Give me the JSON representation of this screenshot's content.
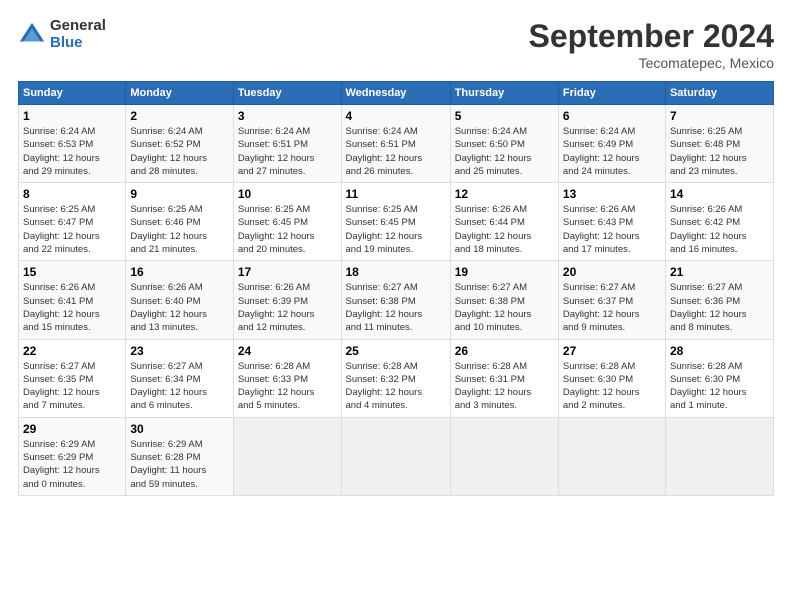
{
  "header": {
    "logo_general": "General",
    "logo_blue": "Blue",
    "month_title": "September 2024",
    "subtitle": "Tecomatepec, Mexico"
  },
  "days_of_week": [
    "Sunday",
    "Monday",
    "Tuesday",
    "Wednesday",
    "Thursday",
    "Friday",
    "Saturday"
  ],
  "weeks": [
    [
      {
        "num": "1",
        "info": "Sunrise: 6:24 AM\nSunset: 6:53 PM\nDaylight: 12 hours\nand 29 minutes."
      },
      {
        "num": "2",
        "info": "Sunrise: 6:24 AM\nSunset: 6:52 PM\nDaylight: 12 hours\nand 28 minutes."
      },
      {
        "num": "3",
        "info": "Sunrise: 6:24 AM\nSunset: 6:51 PM\nDaylight: 12 hours\nand 27 minutes."
      },
      {
        "num": "4",
        "info": "Sunrise: 6:24 AM\nSunset: 6:51 PM\nDaylight: 12 hours\nand 26 minutes."
      },
      {
        "num": "5",
        "info": "Sunrise: 6:24 AM\nSunset: 6:50 PM\nDaylight: 12 hours\nand 25 minutes."
      },
      {
        "num": "6",
        "info": "Sunrise: 6:24 AM\nSunset: 6:49 PM\nDaylight: 12 hours\nand 24 minutes."
      },
      {
        "num": "7",
        "info": "Sunrise: 6:25 AM\nSunset: 6:48 PM\nDaylight: 12 hours\nand 23 minutes."
      }
    ],
    [
      {
        "num": "8",
        "info": "Sunrise: 6:25 AM\nSunset: 6:47 PM\nDaylight: 12 hours\nand 22 minutes."
      },
      {
        "num": "9",
        "info": "Sunrise: 6:25 AM\nSunset: 6:46 PM\nDaylight: 12 hours\nand 21 minutes."
      },
      {
        "num": "10",
        "info": "Sunrise: 6:25 AM\nSunset: 6:45 PM\nDaylight: 12 hours\nand 20 minutes."
      },
      {
        "num": "11",
        "info": "Sunrise: 6:25 AM\nSunset: 6:45 PM\nDaylight: 12 hours\nand 19 minutes."
      },
      {
        "num": "12",
        "info": "Sunrise: 6:26 AM\nSunset: 6:44 PM\nDaylight: 12 hours\nand 18 minutes."
      },
      {
        "num": "13",
        "info": "Sunrise: 6:26 AM\nSunset: 6:43 PM\nDaylight: 12 hours\nand 17 minutes."
      },
      {
        "num": "14",
        "info": "Sunrise: 6:26 AM\nSunset: 6:42 PM\nDaylight: 12 hours\nand 16 minutes."
      }
    ],
    [
      {
        "num": "15",
        "info": "Sunrise: 6:26 AM\nSunset: 6:41 PM\nDaylight: 12 hours\nand 15 minutes."
      },
      {
        "num": "16",
        "info": "Sunrise: 6:26 AM\nSunset: 6:40 PM\nDaylight: 12 hours\nand 13 minutes."
      },
      {
        "num": "17",
        "info": "Sunrise: 6:26 AM\nSunset: 6:39 PM\nDaylight: 12 hours\nand 12 minutes."
      },
      {
        "num": "18",
        "info": "Sunrise: 6:27 AM\nSunset: 6:38 PM\nDaylight: 12 hours\nand 11 minutes."
      },
      {
        "num": "19",
        "info": "Sunrise: 6:27 AM\nSunset: 6:38 PM\nDaylight: 12 hours\nand 10 minutes."
      },
      {
        "num": "20",
        "info": "Sunrise: 6:27 AM\nSunset: 6:37 PM\nDaylight: 12 hours\nand 9 minutes."
      },
      {
        "num": "21",
        "info": "Sunrise: 6:27 AM\nSunset: 6:36 PM\nDaylight: 12 hours\nand 8 minutes."
      }
    ],
    [
      {
        "num": "22",
        "info": "Sunrise: 6:27 AM\nSunset: 6:35 PM\nDaylight: 12 hours\nand 7 minutes."
      },
      {
        "num": "23",
        "info": "Sunrise: 6:27 AM\nSunset: 6:34 PM\nDaylight: 12 hours\nand 6 minutes."
      },
      {
        "num": "24",
        "info": "Sunrise: 6:28 AM\nSunset: 6:33 PM\nDaylight: 12 hours\nand 5 minutes."
      },
      {
        "num": "25",
        "info": "Sunrise: 6:28 AM\nSunset: 6:32 PM\nDaylight: 12 hours\nand 4 minutes."
      },
      {
        "num": "26",
        "info": "Sunrise: 6:28 AM\nSunset: 6:31 PM\nDaylight: 12 hours\nand 3 minutes."
      },
      {
        "num": "27",
        "info": "Sunrise: 6:28 AM\nSunset: 6:30 PM\nDaylight: 12 hours\nand 2 minutes."
      },
      {
        "num": "28",
        "info": "Sunrise: 6:28 AM\nSunset: 6:30 PM\nDaylight: 12 hours\nand 1 minute."
      }
    ],
    [
      {
        "num": "29",
        "info": "Sunrise: 6:29 AM\nSunset: 6:29 PM\nDaylight: 12 hours\nand 0 minutes."
      },
      {
        "num": "30",
        "info": "Sunrise: 6:29 AM\nSunset: 6:28 PM\nDaylight: 11 hours\nand 59 minutes."
      },
      {
        "num": "",
        "info": ""
      },
      {
        "num": "",
        "info": ""
      },
      {
        "num": "",
        "info": ""
      },
      {
        "num": "",
        "info": ""
      },
      {
        "num": "",
        "info": ""
      }
    ]
  ]
}
